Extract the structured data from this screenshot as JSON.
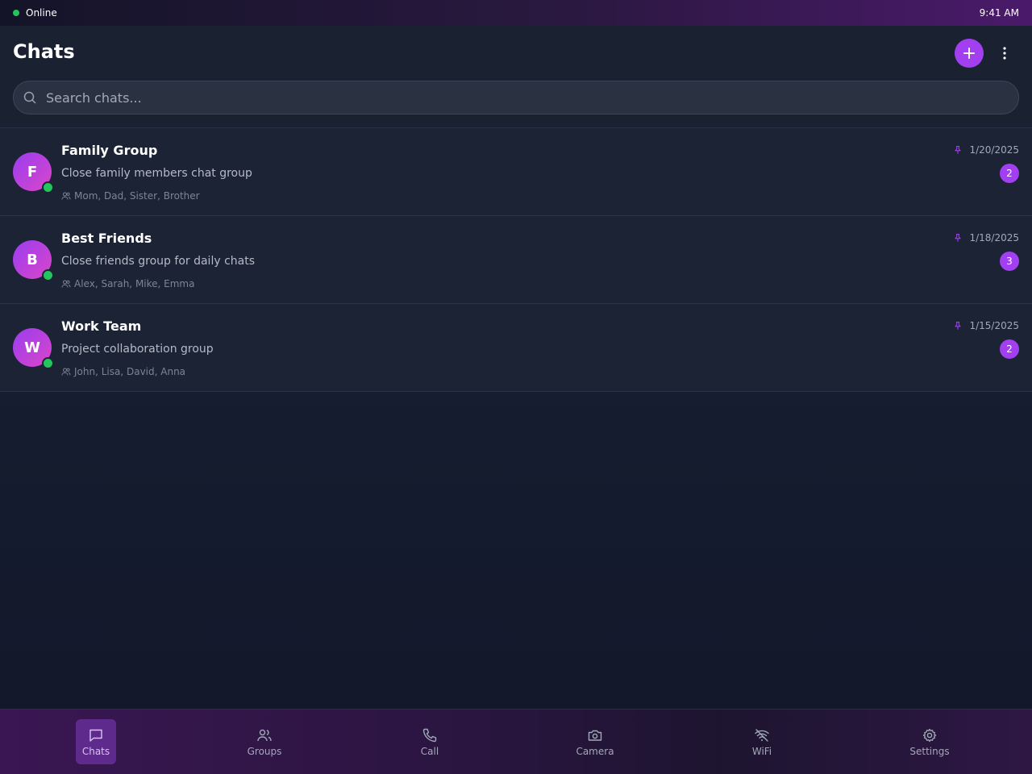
{
  "status": {
    "connection": "Online",
    "time": "9:41 AM"
  },
  "header": {
    "title": "Chats"
  },
  "search": {
    "placeholder": "Search chats..."
  },
  "chats": [
    {
      "initial": "F",
      "name": "Family Group",
      "description": "Close family members chat group",
      "members": "Mom, Dad, Sister, Brother",
      "date": "1/20/2025",
      "unread": "2",
      "pinned": true,
      "online": true
    },
    {
      "initial": "B",
      "name": "Best Friends",
      "description": "Close friends group for daily chats",
      "members": "Alex, Sarah, Mike, Emma",
      "date": "1/18/2025",
      "unread": "3",
      "pinned": true,
      "online": true
    },
    {
      "initial": "W",
      "name": "Work Team",
      "description": "Project collaboration group",
      "members": "John, Lisa, David, Anna",
      "date": "1/15/2025",
      "unread": "2",
      "pinned": true,
      "online": true
    }
  ],
  "nav": [
    {
      "label": "Chats",
      "icon": "chat-bubble-icon",
      "active": true
    },
    {
      "label": "Groups",
      "icon": "users-icon",
      "active": false
    },
    {
      "label": "Call",
      "icon": "phone-icon",
      "active": false
    },
    {
      "label": "Camera",
      "icon": "camera-icon",
      "active": false
    },
    {
      "label": "WiFi",
      "icon": "wifi-off-icon",
      "active": false
    },
    {
      "label": "Settings",
      "icon": "gear-icon",
      "active": false
    }
  ],
  "colors": {
    "accent": "#a23ff0",
    "online": "#22c55e",
    "background": "#1b2334"
  }
}
